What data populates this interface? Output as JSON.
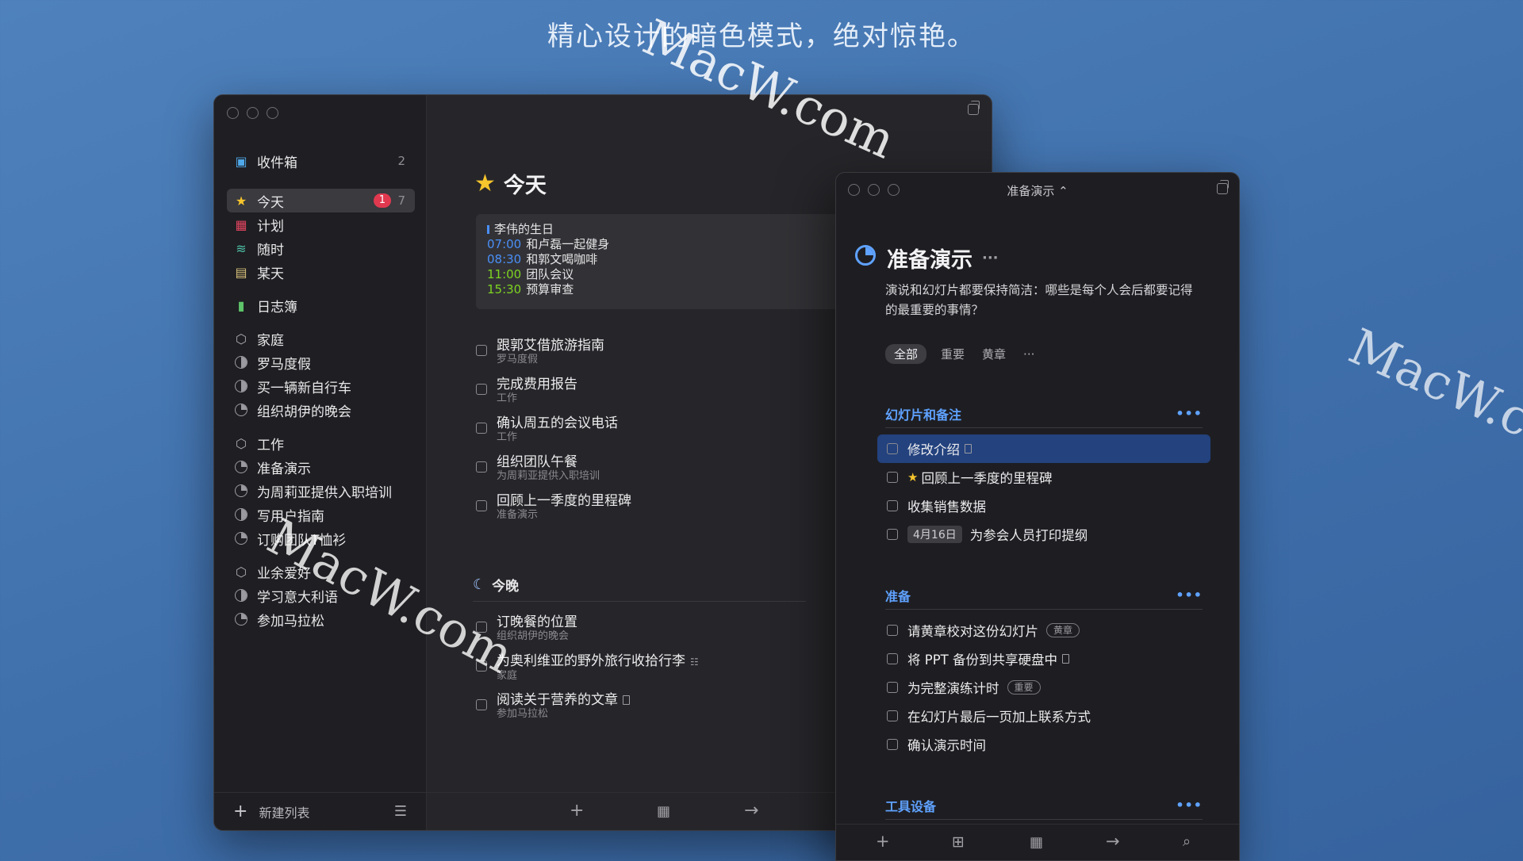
{
  "headline": "精心设计的暗色模式，绝对惊艳。",
  "watermark": "MacW.com",
  "sidebar": {
    "inbox": {
      "label": "收件箱",
      "count": "2"
    },
    "today": {
      "label": "今天",
      "badge": "1",
      "count": "7"
    },
    "upcoming": {
      "label": "计划"
    },
    "anytime": {
      "label": "随时"
    },
    "someday": {
      "label": "某天"
    },
    "logbook": {
      "label": "日志簿"
    },
    "area_home": {
      "label": "家庭",
      "projects": [
        "罗马度假",
        "买一辆新自行车",
        "组织胡伊的晚会"
      ]
    },
    "area_work": {
      "label": "工作",
      "projects": [
        "准备演示",
        "为周莉亚提供入职培训",
        "写用户指南",
        "订购团队T恤衫"
      ]
    },
    "area_hobby": {
      "label": "业余爱好",
      "projects": [
        "学习意大利语",
        "参加马拉松"
      ]
    },
    "new_list": "新建列表"
  },
  "today": {
    "title": "今天",
    "calendar": {
      "birthday": "李伟的生日",
      "events": [
        {
          "time": "07:00",
          "title": "和卢磊一起健身",
          "color": "#4a8ff7"
        },
        {
          "time": "08:30",
          "title": "和郭文喝咖啡",
          "color": "#4a8ff7"
        },
        {
          "time": "11:00",
          "title": "团队会议",
          "color": "#7ed321"
        },
        {
          "time": "15:30",
          "title": "预算审查",
          "color": "#7ed321"
        }
      ]
    },
    "tasks": [
      {
        "title": "跟郭艾借旅游指南",
        "sub": "罗马度假"
      },
      {
        "title": "完成费用报告",
        "sub": "工作"
      },
      {
        "title": "确认周五的会议电话",
        "sub": "工作"
      },
      {
        "title": "组织团队午餐",
        "sub": "为周莉亚提供入职培训"
      },
      {
        "title": "回顾上一季度的里程碑",
        "sub": "准备演示"
      }
    ],
    "evening_title": "今晚",
    "evening_tasks": [
      {
        "title": "订晚餐的位置",
        "sub": "组织胡伊的晚会"
      },
      {
        "title": "为奥利维亚的野外旅行收拾行李",
        "sub": "家庭"
      },
      {
        "title": "阅读关于营养的文章",
        "sub": "参加马拉松"
      }
    ]
  },
  "project": {
    "window_title": "准备演示 ⌃",
    "title": "准备演示",
    "more": "···",
    "description": "演说和幻灯片都要保持简洁：哪些是每个人会后都要记得的最重要的事情？",
    "tags": [
      "全部",
      "重要",
      "黄章",
      "···"
    ],
    "sections": [
      {
        "title": "幻灯片和备注",
        "tasks": [
          {
            "title": "修改介绍"
          },
          {
            "title": "回顾上一季度的里程碑"
          },
          {
            "title": "收集销售数据"
          },
          {
            "title": "为参会人员打印提纲",
            "date": "4月16日"
          }
        ]
      },
      {
        "title": "准备",
        "tasks": [
          {
            "title": "请黄章校对这份幻灯片",
            "tag": "黄章"
          },
          {
            "title": "将 PPT 备份到共享硬盘中"
          },
          {
            "title": "为完整演练计时",
            "tag": "重要"
          },
          {
            "title": "在幻灯片最后一页加上联系方式"
          },
          {
            "title": "确认演示时间"
          }
        ]
      },
      {
        "title": "工具设备"
      }
    ]
  },
  "colors": {
    "accent": "#5fa2ff",
    "badge": "#e0394f",
    "star": "#f7c52c",
    "selection": "#23427e"
  }
}
